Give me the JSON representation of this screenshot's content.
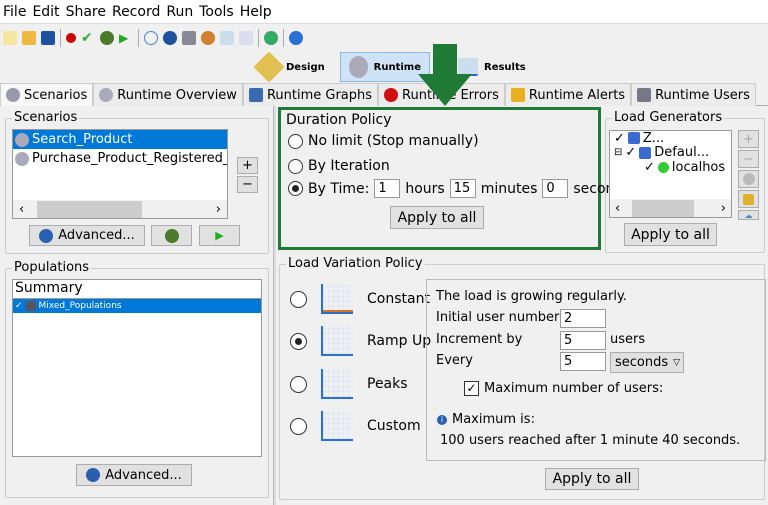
{
  "menu": [
    "File",
    "Edit",
    "Share",
    "Record",
    "Run",
    "Tools",
    "Help"
  ],
  "perspectives": {
    "design": "Design",
    "runtime": "Runtime",
    "results": "Results"
  },
  "tabs": [
    "Scenarios",
    "Runtime Overview",
    "Runtime Graphs",
    "Runtime Errors",
    "Runtime Alerts",
    "Runtime Users"
  ],
  "scenarios": {
    "title": "Scenarios",
    "items": [
      "Search_Product",
      "Purchase_Product_Registered_U"
    ],
    "advanced": "Advanced...",
    "add": "+",
    "remove": "−"
  },
  "populations": {
    "title": "Populations",
    "header": "Summary",
    "items": [
      "Mixed_Populations"
    ],
    "advanced": "Advanced..."
  },
  "duration": {
    "title": "Duration Policy",
    "no_limit": "No limit (Stop manually)",
    "by_iteration": "By Iteration",
    "by_time": "By Time:",
    "hours": "1",
    "hours_label": "hours",
    "minutes": "15",
    "minutes_label": "minutes",
    "seconds": "0",
    "seconds_label": "seconds",
    "apply": "Apply to all",
    "selected": "by_time"
  },
  "generators": {
    "title": "Load Generators",
    "tree": [
      "Z...",
      "Defaul...",
      "localhos"
    ],
    "apply": "Apply to all"
  },
  "load": {
    "title": "Load Variation Policy",
    "options": [
      "Constant",
      "Ramp Up",
      "Peaks",
      "Custom"
    ],
    "selected": "Ramp Up",
    "description": "The load is growing regularly.",
    "initial_label": "Initial user number:",
    "initial": "2",
    "increment_label": "Increment by",
    "increment": "5",
    "users": "users",
    "every_label": "Every",
    "every": "5",
    "unit": "seconds",
    "max_label": "Maximum number of users:",
    "max_checked": true,
    "max_is": "Maximum is:",
    "max_text": "100 users reached after 1 minute 40 seconds.",
    "apply": "Apply to all"
  },
  "colors": {
    "highlight": "#0078d7",
    "annotation": "#1e7a35"
  }
}
